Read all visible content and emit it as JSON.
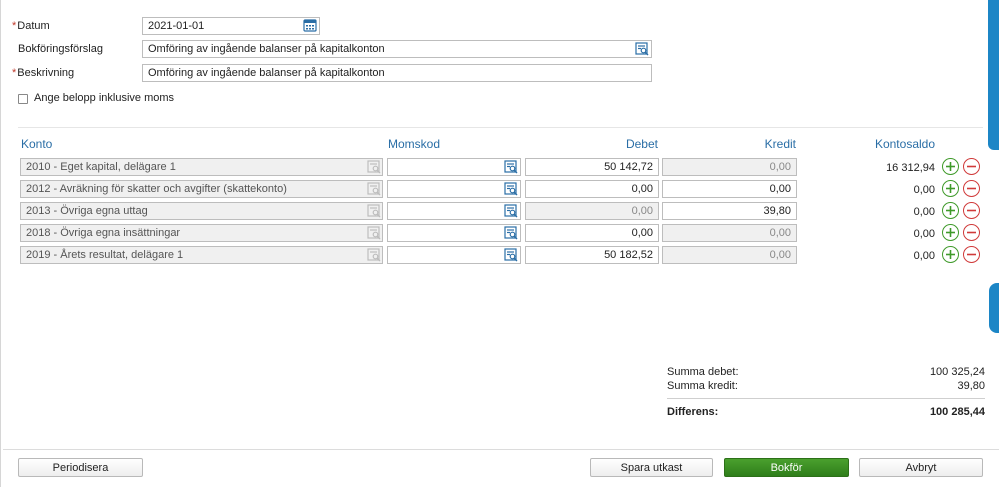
{
  "form": {
    "datum_label": "Datum",
    "datum_value": "2021-01-01",
    "forslag_label": "Bokföringsförslag",
    "forslag_value": "Omföring av ingående balanser på kapitalkonton",
    "beskrivning_label": "Beskrivning",
    "beskrivning_value": "Omföring av ingående balanser på kapitalkonton",
    "moms_checkbox_label": "Ange belopp inklusive moms",
    "required_marker": "*"
  },
  "table": {
    "headers": {
      "konto": "Konto",
      "momskod": "Momskod",
      "debet": "Debet",
      "kredit": "Kredit",
      "kontosaldo": "Kontosaldo"
    },
    "rows": [
      {
        "konto": "2010 - Eget kapital, delägare 1",
        "momskod": "",
        "debet": "50 142,72",
        "kredit": "0,00",
        "saldo": "16 312,94"
      },
      {
        "konto": "2012 - Avräkning för skatter och avgifter (skattekonto)",
        "momskod": "",
        "debet": "0,00",
        "kredit": "0,00",
        "saldo": "0,00"
      },
      {
        "konto": "2013 - Övriga egna uttag",
        "momskod": "",
        "debet": "0,00",
        "kredit": "39,80",
        "saldo": "0,00"
      },
      {
        "konto": "2018 - Övriga egna insättningar",
        "momskod": "",
        "debet": "0,00",
        "kredit": "0,00",
        "saldo": "0,00"
      },
      {
        "konto": "2019 - Årets resultat, delägare 1",
        "momskod": "",
        "debet": "50 182,52",
        "kredit": "0,00",
        "saldo": "0,00"
      }
    ]
  },
  "summary": {
    "debet_label": "Summa debet:",
    "debet_value": "100 325,24",
    "kredit_label": "Summa kredit:",
    "kredit_value": "39,80",
    "diff_label": "Differens:",
    "diff_value": "100 285,44"
  },
  "footer": {
    "periodisera": "Periodisera",
    "spara_utkast": "Spara utkast",
    "bokfor": "Bokför",
    "avbryt": "Avbryt"
  },
  "icons": {
    "calendar": "calendar-icon",
    "lookup": "search-list-icon",
    "add": "plus-circle-icon",
    "remove": "minus-circle-icon"
  },
  "colors": {
    "accent": "#2a6ea6",
    "primary_button": "#3f8f25",
    "add": "#3f9a2a",
    "remove": "#d03a3a",
    "side_tab": "#1c86c6"
  }
}
